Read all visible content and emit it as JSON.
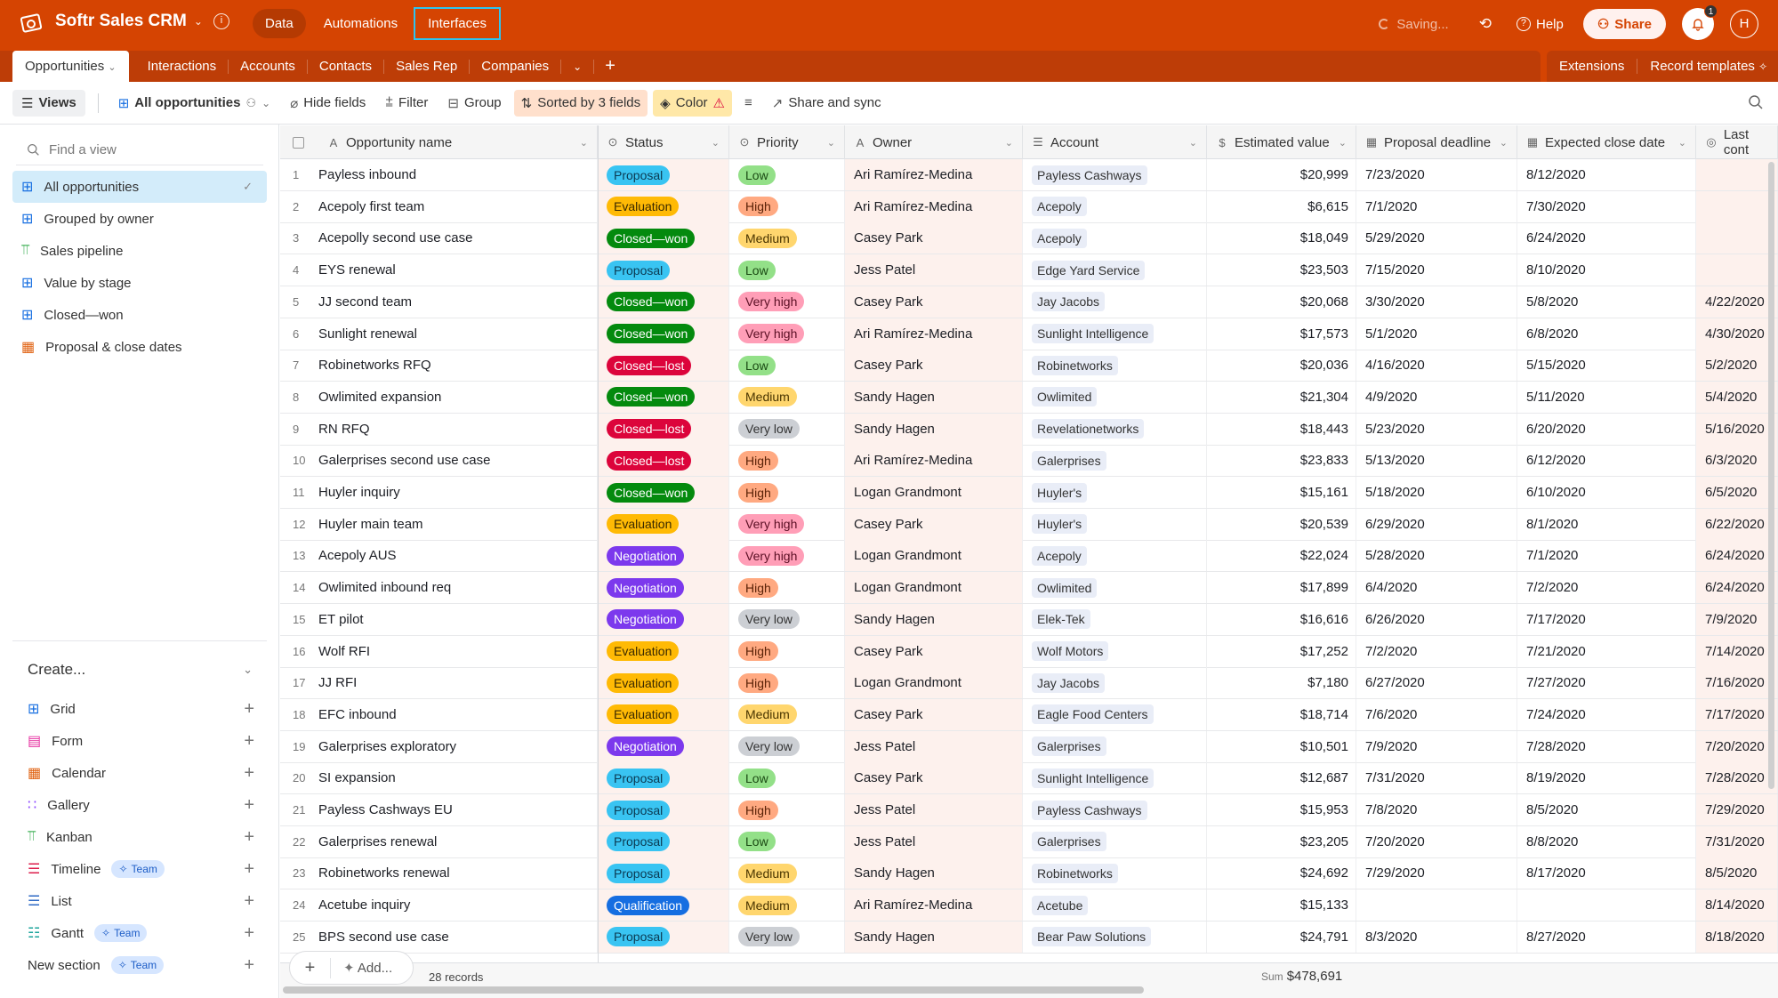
{
  "app": {
    "title": "Softr Sales CRM",
    "nav": [
      "Data",
      "Automations",
      "Interfaces"
    ],
    "saving": "Saving...",
    "help": "Help",
    "share": "Share",
    "notifications_count": "1",
    "avatar_initial": "H"
  },
  "tabs": {
    "active": "Opportunities",
    "items": [
      "Interactions",
      "Accounts",
      "Contacts",
      "Sales Rep",
      "Companies"
    ],
    "extensions": "Extensions",
    "record_templates": "Record templates"
  },
  "toolbar": {
    "views": "Views",
    "current_view": "All opportunities",
    "hide_fields": "Hide fields",
    "filter": "Filter",
    "group": "Group",
    "sorted": "Sorted by 3 fields",
    "color": "Color",
    "share_sync": "Share and sync"
  },
  "sidebar": {
    "find_placeholder": "Find a view",
    "views": [
      {
        "label": "All opportunities",
        "icon": "grid",
        "active": true
      },
      {
        "label": "Grouped by owner",
        "icon": "grid"
      },
      {
        "label": "Sales pipeline",
        "icon": "kanban"
      },
      {
        "label": "Value by stage",
        "icon": "grid"
      },
      {
        "label": "Closed—won",
        "icon": "grid"
      },
      {
        "label": "Proposal & close dates",
        "icon": "calendar"
      }
    ],
    "create_label": "Create...",
    "create_items": [
      {
        "label": "Grid",
        "icon": "grid"
      },
      {
        "label": "Form",
        "icon": "form"
      },
      {
        "label": "Calendar",
        "icon": "calendar"
      },
      {
        "label": "Gallery",
        "icon": "gallery"
      },
      {
        "label": "Kanban",
        "icon": "kanban"
      },
      {
        "label": "Timeline",
        "icon": "timeline",
        "badge": "Team"
      },
      {
        "label": "List",
        "icon": "list"
      },
      {
        "label": "Gantt",
        "icon": "gantt",
        "badge": "Team"
      },
      {
        "label": "New section",
        "icon": "",
        "badge": "Team"
      }
    ]
  },
  "grid": {
    "columns": [
      "Opportunity name",
      "Status",
      "Priority",
      "Owner",
      "Account",
      "Estimated value",
      "Proposal deadline",
      "Expected close date",
      "Last cont"
    ],
    "status_colors": {
      "Proposal": {
        "bg": "#39c4f2",
        "fg": "#0b3a52"
      },
      "Evaluation": {
        "bg": "#ffba05",
        "fg": "#3b2a00"
      },
      "Closed—won": {
        "bg": "#048a0e",
        "fg": "#ffffff"
      },
      "Closed—lost": {
        "bg": "#dc043b",
        "fg": "#ffffff"
      },
      "Negotiation": {
        "bg": "#7c39ed",
        "fg": "#ffffff"
      },
      "Qualification": {
        "bg": "#166ee1",
        "fg": "#ffffff"
      }
    },
    "priority_colors": {
      "Low": {
        "bg": "#93e088",
        "fg": "#1b4a14"
      },
      "Medium": {
        "bg": "#ffd66e",
        "fg": "#4a3500"
      },
      "High": {
        "bg": "#ffa981",
        "fg": "#5a2207"
      },
      "Very high": {
        "bg": "#ff9eb7",
        "fg": "#5a0f24"
      },
      "Very low": {
        "bg": "#cccfd4",
        "fg": "#333333"
      }
    },
    "rows": [
      {
        "n": "1",
        "name": "Payless inbound",
        "status": "Proposal",
        "priority": "Low",
        "owner": "Ari Ramírez-Medina",
        "account": "Payless Cashways",
        "value": "$20,999",
        "deadline": "7/23/2020",
        "close": "8/12/2020",
        "last": ""
      },
      {
        "n": "2",
        "name": "Acepoly first team",
        "status": "Evaluation",
        "priority": "High",
        "owner": "Ari Ramírez-Medina",
        "account": "Acepoly",
        "value": "$6,615",
        "deadline": "7/1/2020",
        "close": "7/30/2020",
        "last": ""
      },
      {
        "n": "3",
        "name": "Acepolly second use case",
        "status": "Closed—won",
        "priority": "Medium",
        "owner": "Casey Park",
        "account": "Acepoly",
        "value": "$18,049",
        "deadline": "5/29/2020",
        "close": "6/24/2020",
        "last": ""
      },
      {
        "n": "4",
        "name": "EYS renewal",
        "status": "Proposal",
        "priority": "Low",
        "owner": "Jess Patel",
        "account": "Edge Yard Service",
        "value": "$23,503",
        "deadline": "7/15/2020",
        "close": "8/10/2020",
        "last": ""
      },
      {
        "n": "5",
        "name": "JJ second team",
        "status": "Closed—won",
        "priority": "Very high",
        "owner": "Casey Park",
        "account": "Jay Jacobs",
        "value": "$20,068",
        "deadline": "3/30/2020",
        "close": "5/8/2020",
        "last": "4/22/2020"
      },
      {
        "n": "6",
        "name": "Sunlight renewal",
        "status": "Closed—won",
        "priority": "Very high",
        "owner": "Ari Ramírez-Medina",
        "account": "Sunlight Intelligence",
        "value": "$17,573",
        "deadline": "5/1/2020",
        "close": "6/8/2020",
        "last": "4/30/2020"
      },
      {
        "n": "7",
        "name": "Robinetworks RFQ",
        "status": "Closed—lost",
        "priority": "Low",
        "owner": "Casey Park",
        "account": "Robinetworks",
        "value": "$20,036",
        "deadline": "4/16/2020",
        "close": "5/15/2020",
        "last": "5/2/2020"
      },
      {
        "n": "8",
        "name": "Owlimited expansion",
        "status": "Closed—won",
        "priority": "Medium",
        "owner": "Sandy Hagen",
        "account": "Owlimited",
        "value": "$21,304",
        "deadline": "4/9/2020",
        "close": "5/11/2020",
        "last": "5/4/2020"
      },
      {
        "n": "9",
        "name": "RN RFQ",
        "status": "Closed—lost",
        "priority": "Very low",
        "owner": "Sandy Hagen",
        "account": "Revelationetworks",
        "value": "$18,443",
        "deadline": "5/23/2020",
        "close": "6/20/2020",
        "last": "5/16/2020"
      },
      {
        "n": "10",
        "name": "Galerprises second use case",
        "status": "Closed—lost",
        "priority": "High",
        "owner": "Ari Ramírez-Medina",
        "account": "Galerprises",
        "value": "$23,833",
        "deadline": "5/13/2020",
        "close": "6/12/2020",
        "last": "6/3/2020"
      },
      {
        "n": "11",
        "name": "Huyler inquiry",
        "status": "Closed—won",
        "priority": "High",
        "owner": "Logan Grandmont",
        "account": "Huyler's",
        "value": "$15,161",
        "deadline": "5/18/2020",
        "close": "6/10/2020",
        "last": "6/5/2020"
      },
      {
        "n": "12",
        "name": "Huyler main team",
        "status": "Evaluation",
        "priority": "Very high",
        "owner": "Casey Park",
        "account": "Huyler's",
        "value": "$20,539",
        "deadline": "6/29/2020",
        "close": "8/1/2020",
        "last": "6/22/2020"
      },
      {
        "n": "13",
        "name": "Acepoly AUS",
        "status": "Negotiation",
        "priority": "Very high",
        "owner": "Logan Grandmont",
        "account": "Acepoly",
        "value": "$22,024",
        "deadline": "5/28/2020",
        "close": "7/1/2020",
        "last": "6/24/2020"
      },
      {
        "n": "14",
        "name": "Owlimited inbound req",
        "status": "Negotiation",
        "priority": "High",
        "owner": "Logan Grandmont",
        "account": "Owlimited",
        "value": "$17,899",
        "deadline": "6/4/2020",
        "close": "7/2/2020",
        "last": "6/24/2020"
      },
      {
        "n": "15",
        "name": "ET pilot",
        "status": "Negotiation",
        "priority": "Very low",
        "owner": "Sandy Hagen",
        "account": "Elek-Tek",
        "value": "$16,616",
        "deadline": "6/26/2020",
        "close": "7/17/2020",
        "last": "7/9/2020"
      },
      {
        "n": "16",
        "name": "Wolf RFI",
        "status": "Evaluation",
        "priority": "High",
        "owner": "Casey Park",
        "account": "Wolf Motors",
        "value": "$17,252",
        "deadline": "7/2/2020",
        "close": "7/21/2020",
        "last": "7/14/2020"
      },
      {
        "n": "17",
        "name": "JJ RFI",
        "status": "Evaluation",
        "priority": "High",
        "owner": "Logan Grandmont",
        "account": "Jay Jacobs",
        "value": "$7,180",
        "deadline": "6/27/2020",
        "close": "7/27/2020",
        "last": "7/16/2020"
      },
      {
        "n": "18",
        "name": "EFC inbound",
        "status": "Evaluation",
        "priority": "Medium",
        "owner": "Casey Park",
        "account": "Eagle Food Centers",
        "value": "$18,714",
        "deadline": "7/6/2020",
        "close": "7/24/2020",
        "last": "7/17/2020"
      },
      {
        "n": "19",
        "name": "Galerprises exploratory",
        "status": "Negotiation",
        "priority": "Very low",
        "owner": "Jess Patel",
        "account": "Galerprises",
        "value": "$10,501",
        "deadline": "7/9/2020",
        "close": "7/28/2020",
        "last": "7/20/2020"
      },
      {
        "n": "20",
        "name": "SI expansion",
        "status": "Proposal",
        "priority": "Low",
        "owner": "Casey Park",
        "account": "Sunlight Intelligence",
        "value": "$12,687",
        "deadline": "7/31/2020",
        "close": "8/19/2020",
        "last": "7/28/2020"
      },
      {
        "n": "21",
        "name": "Payless Cashways EU",
        "status": "Proposal",
        "priority": "High",
        "owner": "Jess Patel",
        "account": "Payless Cashways",
        "value": "$15,953",
        "deadline": "7/8/2020",
        "close": "8/5/2020",
        "last": "7/29/2020"
      },
      {
        "n": "22",
        "name": "Galerprises renewal",
        "status": "Proposal",
        "priority": "Low",
        "owner": "Jess Patel",
        "account": "Galerprises",
        "value": "$23,205",
        "deadline": "7/20/2020",
        "close": "8/8/2020",
        "last": "7/31/2020"
      },
      {
        "n": "23",
        "name": "Robinetworks renewal",
        "status": "Proposal",
        "priority": "Medium",
        "owner": "Sandy Hagen",
        "account": "Robinetworks",
        "value": "$24,692",
        "deadline": "7/29/2020",
        "close": "8/17/2020",
        "last": "8/5/2020"
      },
      {
        "n": "24",
        "name": "Acetube inquiry",
        "status": "Qualification",
        "priority": "Medium",
        "owner": "Ari Ramírez-Medina",
        "account": "Acetube",
        "value": "$15,133",
        "deadline": "",
        "close": "",
        "last": "8/14/2020"
      },
      {
        "n": "25",
        "name": "BPS second use case",
        "status": "Proposal",
        "priority": "Very low",
        "owner": "Sandy Hagen",
        "account": "Bear Paw Solutions",
        "value": "$24,791",
        "deadline": "8/3/2020",
        "close": "8/27/2020",
        "last": "8/18/2020"
      }
    ]
  },
  "footer": {
    "add_label": "Add...",
    "records": "28 records",
    "sum_label": "Sum",
    "sum_value": "$478,691"
  }
}
